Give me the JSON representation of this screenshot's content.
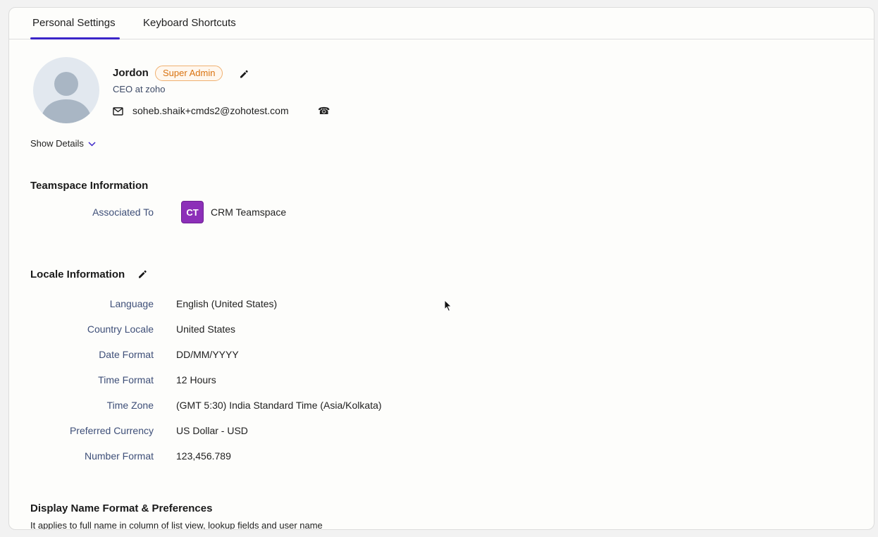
{
  "tabs": [
    {
      "label": "Personal Settings",
      "active": true
    },
    {
      "label": "Keyboard Shortcuts",
      "active": false
    }
  ],
  "profile": {
    "name": "Jordon",
    "badge": "Super Admin",
    "role": "CEO  at  zoho",
    "email": "soheb.shaik+cmds2@zohotest.com",
    "show_details": "Show Details"
  },
  "teamspace": {
    "title": "Teamspace Information",
    "associated_label": "Associated To",
    "badge_initials": "CT",
    "name": "CRM Teamspace"
  },
  "locale": {
    "title": "Locale Information",
    "fields": [
      {
        "label": "Language",
        "value": "English (United States)"
      },
      {
        "label": "Country Locale",
        "value": "United States"
      },
      {
        "label": "Date Format",
        "value": "DD/MM/YYYY"
      },
      {
        "label": "Time Format",
        "value": "12 Hours"
      },
      {
        "label": "Time Zone",
        "value": "(GMT 5:30) India Standard Time (Asia/Kolkata)"
      },
      {
        "label": "Preferred Currency",
        "value": "US Dollar - USD"
      },
      {
        "label": "Number Format",
        "value": "123,456.789"
      }
    ]
  },
  "display_name": {
    "title": "Display Name Format & Preferences",
    "note": "It applies to full name in column of list view, lookup fields and user name"
  },
  "colors": {
    "accent": "#3b25c8",
    "badge_orange": "#d9720f",
    "teamspace_purple": "#8c2fb8",
    "label_blue": "#3e4f78"
  },
  "icons": [
    "pencil-icon",
    "mail-icon",
    "phone-icon",
    "chevron-down-icon",
    "user-avatar-icon",
    "mouse-cursor-icon"
  ]
}
